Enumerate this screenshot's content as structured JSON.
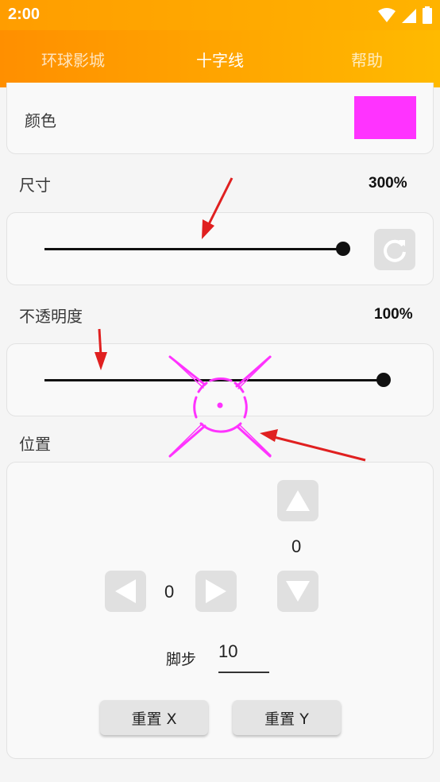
{
  "status": {
    "time": "2:00"
  },
  "tabs": [
    {
      "label": "环球影城"
    },
    {
      "label": "十字线"
    },
    {
      "label": "帮助"
    }
  ],
  "color_section": {
    "label": "颜色",
    "swatch_color": "#ff33ff"
  },
  "size_section": {
    "label": "尺寸",
    "value": "300%",
    "slider_fraction": 1.0
  },
  "opacity_section": {
    "label": "不透明度",
    "value": "100%",
    "slider_fraction": 1.0
  },
  "position_section": {
    "label": "位置",
    "y_value": "0",
    "x_value": "0",
    "step_label": "脚步",
    "step_value": "10",
    "reset_x_label": "重置 X",
    "reset_y_label": "重置 Y"
  },
  "colors": {
    "accent": "#ffa000",
    "crosshair": "#ff33ff",
    "arrow": "#e02020"
  }
}
